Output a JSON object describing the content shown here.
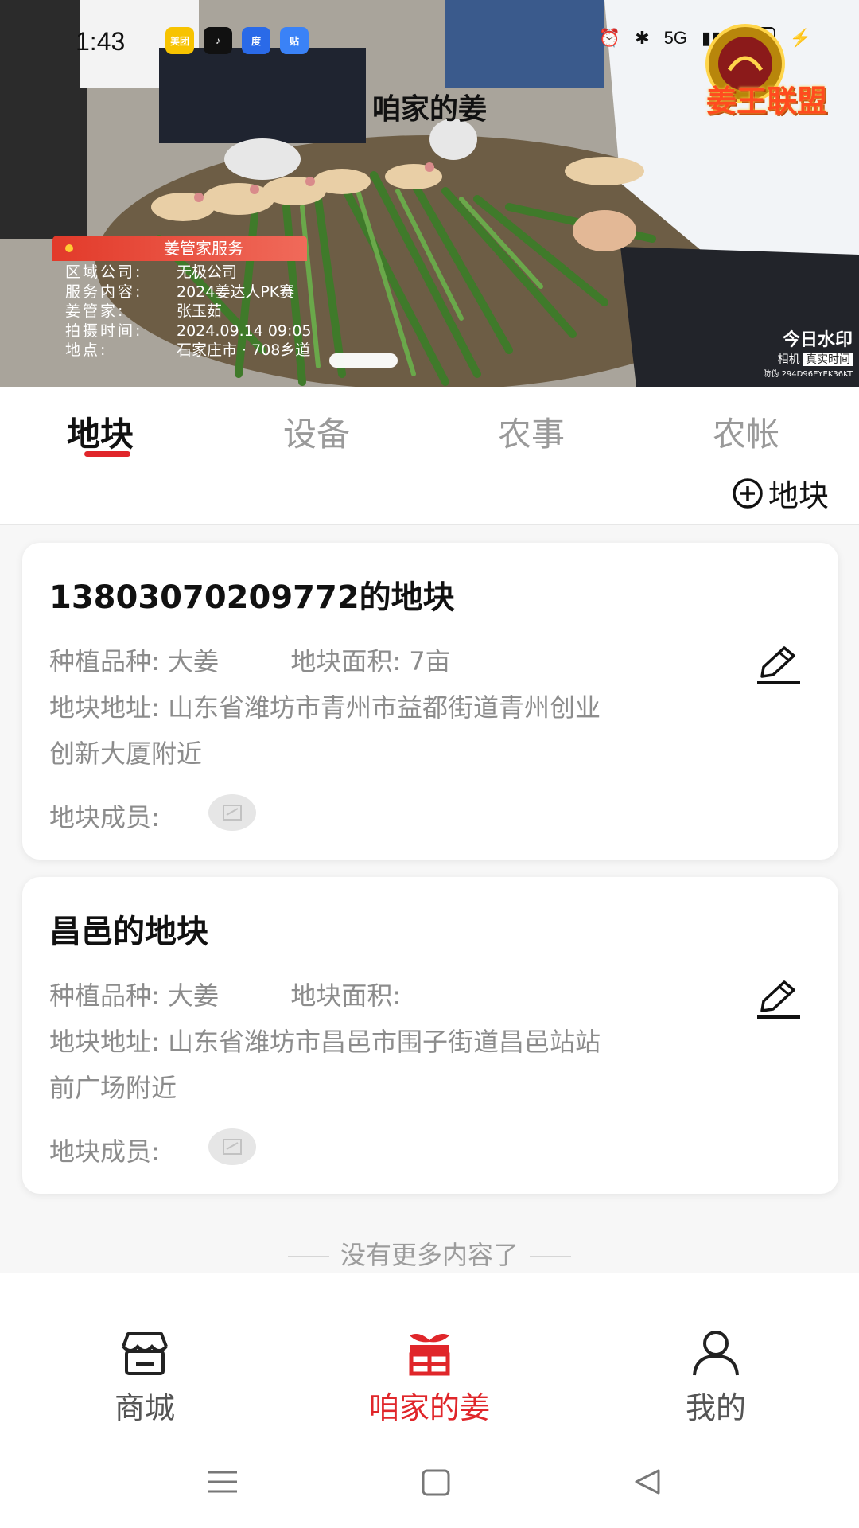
{
  "status_bar": {
    "time": "1:43",
    "apps": [
      {
        "name": "meituan-app-icon",
        "label": "美团",
        "color": "#f7c300"
      },
      {
        "name": "tiktok-app-icon",
        "label": "♪",
        "color": "#111111"
      },
      {
        "name": "baidu-app-icon",
        "label": "度",
        "color": "#2a6ae8"
      },
      {
        "name": "tieba-app-icon",
        "label": "贴",
        "color": "#3a82f7"
      }
    ],
    "network": "5G",
    "battery": "57"
  },
  "hero": {
    "title": "咱家的姜",
    "brand_text": "姜王联盟",
    "watermark": {
      "header": "姜管家服务",
      "rows": [
        {
          "key": "区域公司:",
          "value": "无极公司"
        },
        {
          "key": "服务内容:",
          "value": "2024姜达人PK赛"
        },
        {
          "key": "姜管家:",
          "value": "张玉茹"
        },
        {
          "key": "拍摄时间:",
          "value": "2024.09.14 09:05"
        },
        {
          "key": "地点:",
          "value": "石家庄市 · 708乡道"
        }
      ]
    },
    "camera_watermark": {
      "title": "今日水印",
      "sub_a": "相机",
      "sub_b": "真实时间",
      "code": "防伪 294D96EYEK36KT"
    }
  },
  "tabs": [
    {
      "label": "地块",
      "active": true
    },
    {
      "label": "设备",
      "active": false
    },
    {
      "label": "农事",
      "active": false
    },
    {
      "label": "农帐",
      "active": false
    }
  ],
  "add_plot_label": "地块",
  "plots": [
    {
      "title": "13803070209772的地块",
      "variety_label": "种植品种:",
      "variety": "大姜",
      "area_label": "地块面积:",
      "area": "7亩",
      "address_label": "地块地址:",
      "address": "山东省潍坊市青州市益都街道青州创业创新大厦附近",
      "members_label": "地块成员:"
    },
    {
      "title": "昌邑的地块",
      "variety_label": "种植品种:",
      "variety": "大姜",
      "area_label": "地块面积:",
      "area": "",
      "address_label": "地块地址:",
      "address": "山东省潍坊市昌邑市围子街道昌邑站站前广场附近",
      "members_label": "地块成员:"
    }
  ],
  "end_note": "没有更多内容了",
  "bottom_nav": [
    {
      "label": "商城",
      "icon": "shop-icon",
      "active": false
    },
    {
      "label": "咱家的姜",
      "icon": "ginger-home-icon",
      "active": true
    },
    {
      "label": "我的",
      "icon": "profile-icon",
      "active": false
    }
  ],
  "colors": {
    "accent": "#e0262a",
    "muted_text": "#8c8c8c"
  }
}
